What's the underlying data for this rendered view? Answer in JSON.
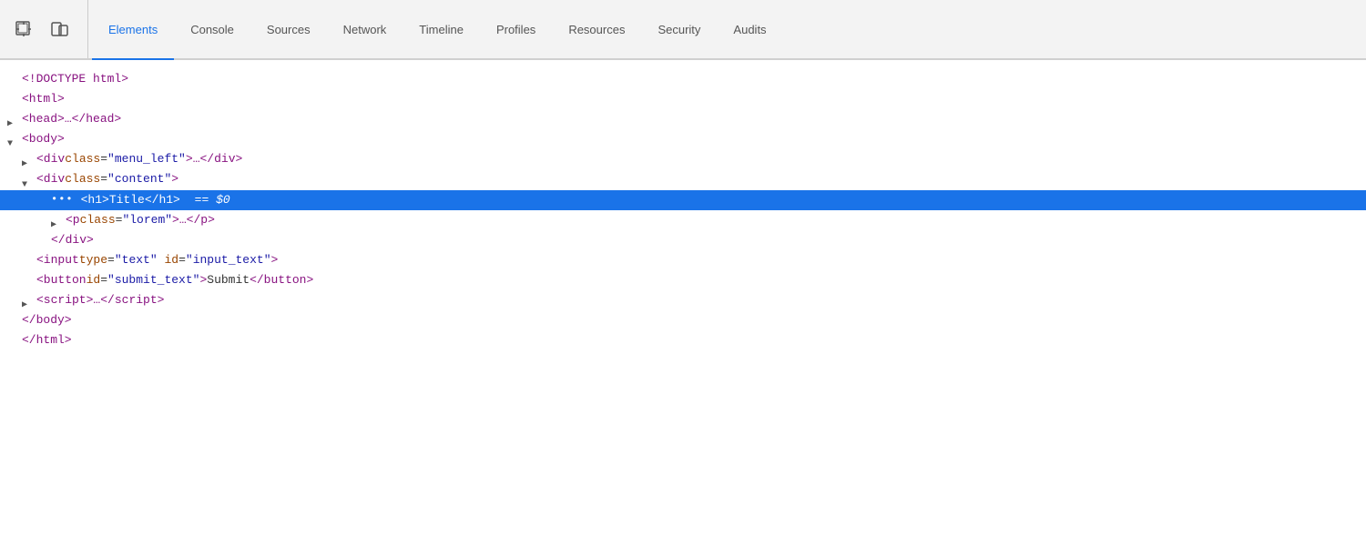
{
  "toolbar": {
    "icons": [
      {
        "name": "cursor-icon",
        "label": "Inspect element",
        "symbol": "cursor"
      },
      {
        "name": "device-icon",
        "label": "Toggle device toolbar",
        "symbol": "device"
      }
    ],
    "tabs": [
      {
        "id": "elements",
        "label": "Elements",
        "active": true
      },
      {
        "id": "console",
        "label": "Console",
        "active": false
      },
      {
        "id": "sources",
        "label": "Sources",
        "active": false
      },
      {
        "id": "network",
        "label": "Network",
        "active": false
      },
      {
        "id": "timeline",
        "label": "Timeline",
        "active": false
      },
      {
        "id": "profiles",
        "label": "Profiles",
        "active": false
      },
      {
        "id": "resources",
        "label": "Resources",
        "active": false
      },
      {
        "id": "security",
        "label": "Security",
        "active": false
      },
      {
        "id": "audits",
        "label": "Audits",
        "active": false
      }
    ]
  },
  "code": {
    "lines": [
      {
        "id": "doctype",
        "indent": 0,
        "triangle": "none",
        "dots": false,
        "selected": false,
        "html": "doctype"
      },
      {
        "id": "html-open",
        "indent": 0,
        "triangle": "none",
        "dots": false,
        "selected": false,
        "html": "html-open"
      },
      {
        "id": "head",
        "indent": 0,
        "triangle": "right",
        "dots": false,
        "selected": false,
        "html": "head"
      },
      {
        "id": "body-open",
        "indent": 0,
        "triangle": "down",
        "dots": false,
        "selected": false,
        "html": "body-open"
      },
      {
        "id": "div-menu",
        "indent": 1,
        "triangle": "right",
        "dots": false,
        "selected": false,
        "html": "div-menu"
      },
      {
        "id": "div-content",
        "indent": 1,
        "triangle": "down",
        "dots": false,
        "selected": false,
        "html": "div-content"
      },
      {
        "id": "h1",
        "indent": 2,
        "triangle": "none",
        "dots": true,
        "selected": true,
        "html": "h1"
      },
      {
        "id": "p-lorem",
        "indent": 2,
        "triangle": "right",
        "dots": false,
        "selected": false,
        "html": "p-lorem"
      },
      {
        "id": "div-close",
        "indent": 2,
        "triangle": "none",
        "dots": false,
        "selected": false,
        "html": "div-close"
      },
      {
        "id": "input",
        "indent": 1,
        "triangle": "none",
        "dots": false,
        "selected": false,
        "html": "input"
      },
      {
        "id": "button",
        "indent": 1,
        "triangle": "none",
        "dots": false,
        "selected": false,
        "html": "button"
      },
      {
        "id": "script",
        "indent": 1,
        "triangle": "right",
        "dots": false,
        "selected": false,
        "html": "script"
      },
      {
        "id": "body-close",
        "indent": 0,
        "triangle": "none",
        "dots": false,
        "selected": false,
        "html": "body-close"
      },
      {
        "id": "html-close",
        "indent": 0,
        "triangle": "none",
        "dots": false,
        "selected": false,
        "html": "html-close"
      }
    ]
  }
}
